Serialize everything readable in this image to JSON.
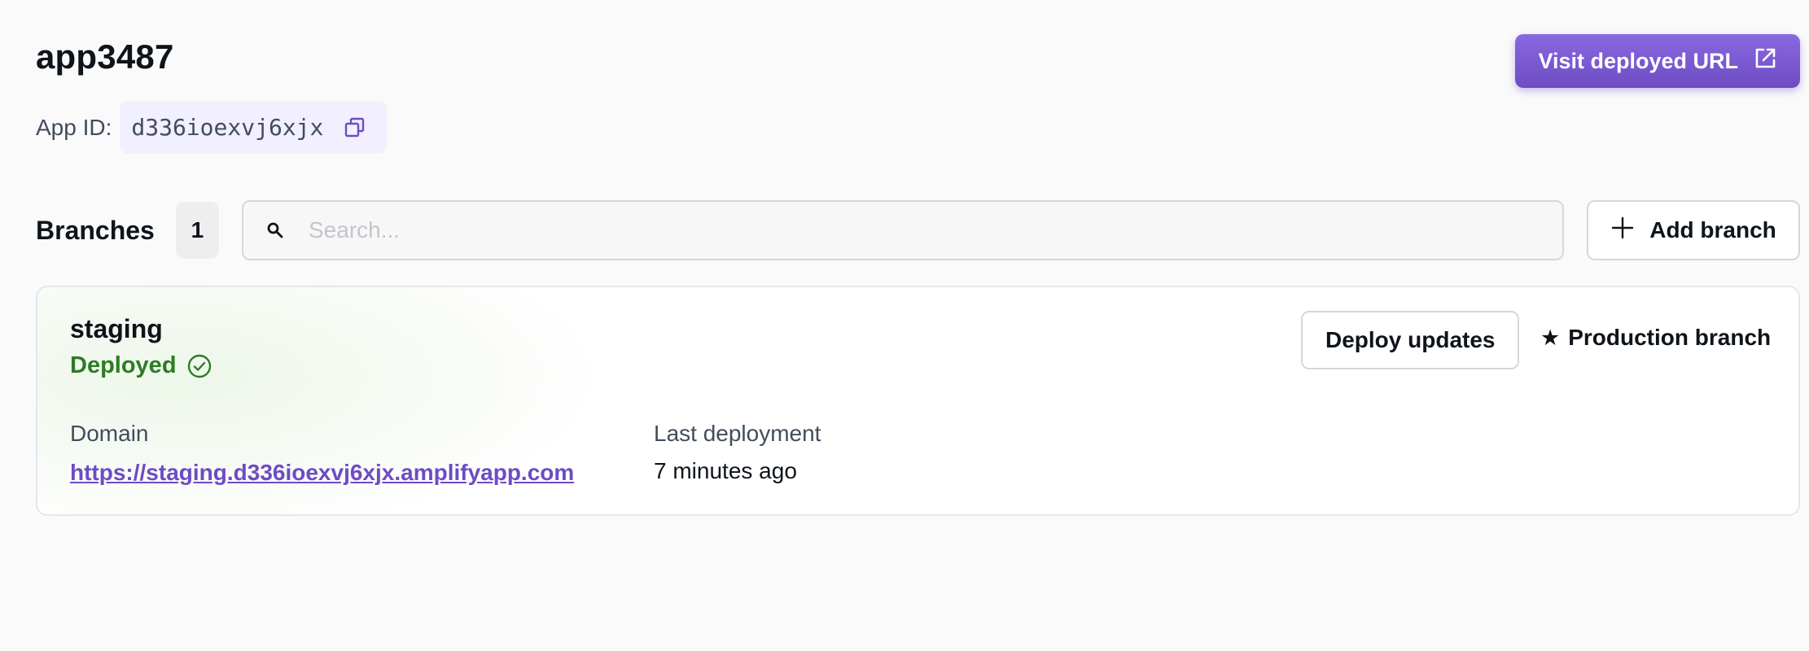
{
  "app": {
    "name": "app3487",
    "id_label": "App ID:",
    "id_value": "d336ioexvj6xjx",
    "visit_button_label": "Visit deployed URL"
  },
  "branches": {
    "label": "Branches",
    "count": "1",
    "search_placeholder": "Search...",
    "add_button_label": "Add branch",
    "items": [
      {
        "name": "staging",
        "status": "Deployed",
        "deploy_button_label": "Deploy updates",
        "production_label": "Production branch",
        "domain_label": "Domain",
        "domain_url": "https://staging.d336ioexvj6xjx.amplifyapp.com",
        "last_deployment_label": "Last deployment",
        "last_deployment_value": "7 minutes ago"
      }
    ]
  },
  "colors": {
    "accent": "#6d4cc4",
    "status_success": "#2b7c25",
    "background": "#fafafa"
  },
  "icons": {
    "copy": "copy-icon",
    "external_link": "external-link-icon",
    "search": "search-icon",
    "add": "plus-icon",
    "status": "check-circle-icon",
    "production": "star-icon"
  }
}
